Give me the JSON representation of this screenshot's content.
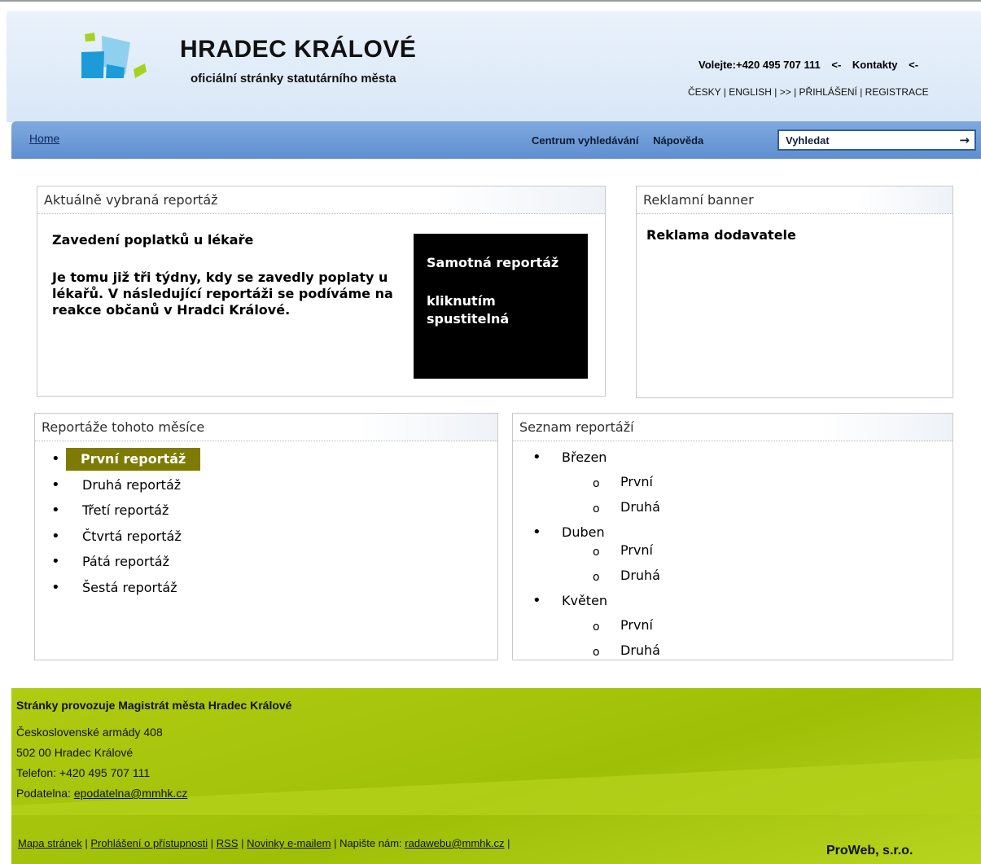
{
  "header": {
    "title": "HRADEC KRÁLOVÉ",
    "subtitle": "oficiální stránky statutárního města",
    "call_text": "Volejte:+420 495 707 111",
    "arrow_left": "<-",
    "contacts": "Kontakty",
    "arrow_right": "<-",
    "lang_line": "ČESKY | ENGLISH | >> | PŘIHLÁŠENÍ | REGISTRACE"
  },
  "nav": {
    "home": "Home",
    "search_center": "Centrum vyhledávání",
    "help": "Nápověda",
    "search_value": "Vyhledat",
    "search_arrow": "→"
  },
  "current_report": {
    "heading": "Aktuálně vybraná reportáž",
    "title": "Zavedení poplatků u lékaře",
    "text": "Je tomu již tři týdny, kdy se zavedly poplaty u lékařů. V následující reportáži se podíváme na reakce občanů v Hradci Králové.",
    "video_line1": "Samotná reportáž",
    "video_line2": "kliknutím spustitelná"
  },
  "banner": {
    "heading": "Reklamní banner",
    "text": "Reklama dodavatele"
  },
  "month_reports": {
    "heading": "Reportáže tohoto měsíce",
    "items": [
      "První reportáž",
      "Druhá reportáž",
      "Třetí reportáž",
      "Čtvrtá reportáž",
      "Pátá reportáž",
      "Šestá reportáž"
    ]
  },
  "report_list": {
    "heading": "Seznam reportáží",
    "months": [
      {
        "name": "Březen",
        "items": [
          "První",
          "Druhá"
        ]
      },
      {
        "name": "Duben",
        "items": [
          "První",
          "Druhá"
        ]
      },
      {
        "name": "Květen",
        "items": [
          "První",
          "Druhá"
        ]
      }
    ]
  },
  "footer": {
    "title": "Stránky provozuje Magistrát města Hradec Králové",
    "address1": "Československé armády 408",
    "address2": "502 00 Hradec Králové",
    "phone": "Telefon: +420 495 707 111",
    "filing_label": "Podatelna: ",
    "filing_email": "epodatelna@mmhk.cz",
    "links": [
      "Mapa stránek",
      "Prohlášení o přístupnosti",
      "RSS",
      "Novinky e-mailem"
    ],
    "write_label": "Napište nám: ",
    "write_email": "radawebu@mmhk.cz",
    "company": "ProWeb, s.r.o."
  },
  "colors": {
    "nav_blue": "#6d9bd8",
    "footer_green": "#a9c60e",
    "active_item": "#7e7b05"
  }
}
